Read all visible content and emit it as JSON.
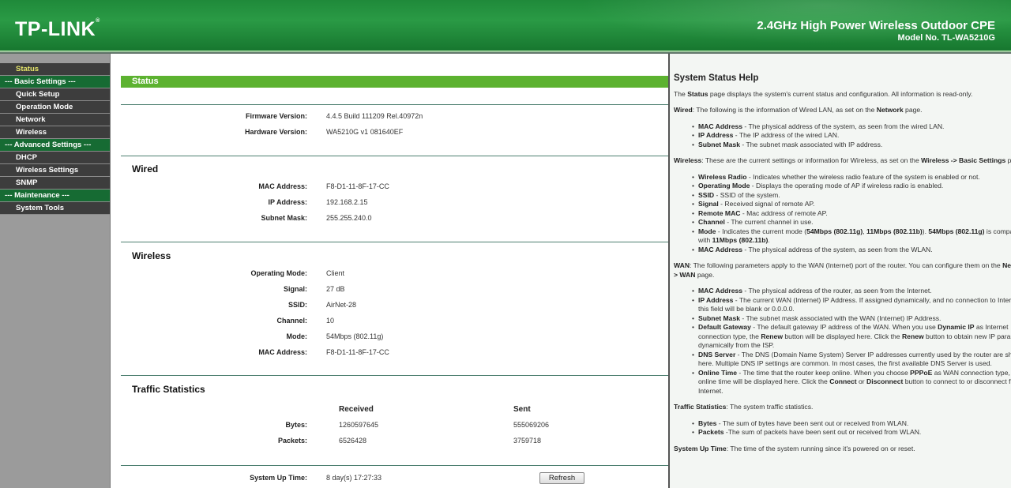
{
  "header": {
    "logo": "TP-LINK",
    "product": "2.4GHz High Power Wireless Outdoor CPE",
    "model": "Model No. TL-WA5210G"
  },
  "sidebar": {
    "items": [
      {
        "label": "Status",
        "type": "item",
        "active": true
      },
      {
        "label": "--- Basic Settings ---",
        "type": "group"
      },
      {
        "label": "Quick Setup",
        "type": "item"
      },
      {
        "label": "Operation Mode",
        "type": "item"
      },
      {
        "label": "Network",
        "type": "item"
      },
      {
        "label": "Wireless",
        "type": "item"
      },
      {
        "label": "--- Advanced Settings ---",
        "type": "group"
      },
      {
        "label": "DHCP",
        "type": "item"
      },
      {
        "label": "Wireless Settings",
        "type": "item"
      },
      {
        "label": "SNMP",
        "type": "item"
      },
      {
        "label": "--- Maintenance ---",
        "type": "group"
      },
      {
        "label": "System Tools",
        "type": "item"
      }
    ]
  },
  "main": {
    "title": "Status",
    "general": [
      {
        "label": "Firmware Version:",
        "value": "4.4.5 Build 111209 Rel.40972n"
      },
      {
        "label": "Hardware Version:",
        "value": "WA5210G v1 081640EF"
      }
    ],
    "wired": {
      "title": "Wired",
      "rows": [
        {
          "label": "MAC Address:",
          "value": "F8-D1-11-8F-17-CC"
        },
        {
          "label": "IP Address:",
          "value": "192.168.2.15"
        },
        {
          "label": "Subnet Mask:",
          "value": "255.255.240.0"
        }
      ]
    },
    "wireless": {
      "title": "Wireless",
      "rows": [
        {
          "label": "Operating Mode:",
          "value": "Client"
        },
        {
          "label": "Signal:",
          "value": "27 dB"
        },
        {
          "label": "SSID:",
          "value": "AirNet-28"
        },
        {
          "label": "Channel:",
          "value": "10"
        },
        {
          "label": "Mode:",
          "value": "54Mbps (802.11g)"
        },
        {
          "label": "MAC Address:",
          "value": "F8-D1-11-8F-17-CC"
        }
      ]
    },
    "traffic": {
      "title": "Traffic Statistics",
      "col_received": "Received",
      "col_sent": "Sent",
      "rows": [
        {
          "label": "Bytes:",
          "received": "1260597645",
          "sent": "555069206"
        },
        {
          "label": "Packets:",
          "received": "6526428",
          "sent": "3759718"
        }
      ]
    },
    "uptime": {
      "label": "System Up Time:",
      "value": "8 day(s) 17:27:33"
    },
    "refresh_label": "Refresh"
  },
  "help": {
    "title": "System Status Help",
    "blocks": [
      {
        "type": "p",
        "segs": [
          [
            "The ",
            0
          ],
          [
            "Status",
            1
          ],
          [
            " page displays the system's current status and configuration. All information is read-only.",
            0
          ]
        ]
      },
      {
        "type": "p",
        "segs": [
          [
            "Wired",
            1
          ],
          [
            ": The following is the information of Wired LAN, as set on the ",
            0
          ],
          [
            "Network",
            1
          ],
          [
            " page.",
            0
          ]
        ]
      },
      {
        "type": "ul",
        "items": [
          [
            [
              "MAC Address",
              1
            ],
            [
              " - The physical address of the system, as seen from the wired LAN.",
              0
            ]
          ],
          [
            [
              "IP Address",
              1
            ],
            [
              " - The IP address of the wired LAN.",
              0
            ]
          ],
          [
            [
              "Subnet Mask",
              1
            ],
            [
              " - The subnet mask associated with IP address.",
              0
            ]
          ]
        ]
      },
      {
        "type": "p",
        "segs": [
          [
            "Wireless",
            1
          ],
          [
            ": These are the current settings or information for Wireless, as set on the ",
            0
          ],
          [
            "Wireless -> Basic Settings",
            1
          ],
          [
            " page.",
            0
          ]
        ]
      },
      {
        "type": "ul",
        "items": [
          [
            [
              "Wireless Radio",
              1
            ],
            [
              " - Indicates whether the wireless radio feature of the system is enabled or not.",
              0
            ]
          ],
          [
            [
              "Operating Mode",
              1
            ],
            [
              " - Displays the operating mode of AP if wireless radio is enabled.",
              0
            ]
          ],
          [
            [
              "SSID",
              1
            ],
            [
              " - SSID of the system.",
              0
            ]
          ],
          [
            [
              "Signal",
              1
            ],
            [
              " - Received signal of remote AP.",
              0
            ]
          ],
          [
            [
              "Remote MAC",
              1
            ],
            [
              " - Mac address of remote AP.",
              0
            ]
          ],
          [
            [
              "Channel",
              1
            ],
            [
              " - The current channel in use.",
              0
            ]
          ],
          [
            [
              "Mode",
              1
            ],
            [
              " - Indicates the current mode (",
              0
            ],
            [
              "54Mbps (802.11g)",
              1
            ],
            [
              ", ",
              0
            ],
            [
              "11Mbps (802.11b)",
              1
            ],
            [
              "). ",
              0
            ],
            [
              "54Mbps (802.11g)",
              1
            ],
            [
              " is compatible with ",
              0
            ],
            [
              "11Mbps (802.11b)",
              1
            ],
            [
              ".",
              0
            ]
          ],
          [
            [
              "MAC Address",
              1
            ],
            [
              " - The physical address of the system, as seen from the WLAN.",
              0
            ]
          ]
        ]
      },
      {
        "type": "p",
        "segs": [
          [
            "WAN",
            1
          ],
          [
            ": The following parameters apply to the WAN (Internet) port of the router. You can configure them on the ",
            0
          ],
          [
            "Network -> WAN",
            1
          ],
          [
            " page.",
            0
          ]
        ]
      },
      {
        "type": "ul",
        "items": [
          [
            [
              "MAC Address",
              1
            ],
            [
              " - The physical address of the router, as seen from the Internet.",
              0
            ]
          ],
          [
            [
              "IP Address",
              1
            ],
            [
              " - The current WAN (Internet) IP Address. If assigned dynamically, and no connection to Internet, this field will be blank or 0.0.0.0.",
              0
            ]
          ],
          [
            [
              "Subnet Mask",
              1
            ],
            [
              " - The subnet mask associated with the WAN (Internet) IP Address.",
              0
            ]
          ],
          [
            [
              "Default Gateway",
              1
            ],
            [
              " - The default gateway IP address of the WAN. When you use ",
              0
            ],
            [
              "Dynamic IP",
              1
            ],
            [
              " as Internet connection type, the ",
              0
            ],
            [
              "Renew",
              1
            ],
            [
              " button will be displayed here. Click the ",
              0
            ],
            [
              "Renew",
              1
            ],
            [
              " button to obtain new IP parameters dynamically from the ISP.",
              0
            ]
          ],
          [
            [
              "DNS Server",
              1
            ],
            [
              " - The DNS (Domain Name System) Server IP addresses currently used by the router are shown here. Multiple DNS IP settings are common. In most cases, the first available DNS Server is used.",
              0
            ]
          ],
          [
            [
              "Online Time",
              1
            ],
            [
              " - The time that the router keep online. When you choose ",
              0
            ],
            [
              "PPPoE",
              1
            ],
            [
              " as WAN connection type, the online time will be displayed here. Click the ",
              0
            ],
            [
              "Connect",
              1
            ],
            [
              " or ",
              0
            ],
            [
              "Disconnect",
              1
            ],
            [
              " button to connect to or disconnect from Internet.",
              0
            ]
          ]
        ]
      },
      {
        "type": "p",
        "segs": [
          [
            "Traffic Statistics",
            1
          ],
          [
            ": The system traffic statistics.",
            0
          ]
        ]
      },
      {
        "type": "ul",
        "items": [
          [
            [
              "Bytes",
              1
            ],
            [
              " - The sum of bytes have been sent out or received from WLAN.",
              0
            ]
          ],
          [
            [
              "Packets",
              1
            ],
            [
              " -The sum of packets have been sent out or received from WLAN.",
              0
            ]
          ]
        ]
      },
      {
        "type": "p",
        "segs": [
          [
            "System Up Time",
            1
          ],
          [
            ": The time of the system running since it's powered on or reset.",
            0
          ]
        ]
      }
    ]
  }
}
